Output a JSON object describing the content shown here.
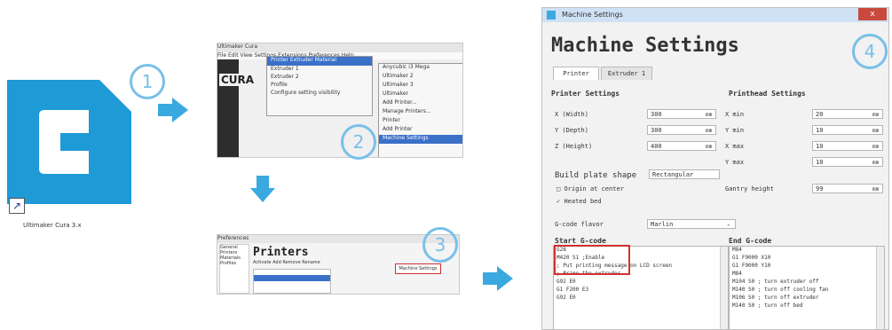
{
  "steps": [
    "1",
    "2",
    "3",
    "4"
  ],
  "colors": {
    "cura_blue": "#1e9ad6",
    "arrow_blue": "#3aa9e0",
    "highlight_red": "#d03030",
    "selection_blue": "#3a70c8"
  },
  "icon_caption": "Ultimaker Cura 3.x",
  "panel2": {
    "title": "Ultimaker Cura",
    "menu": "File  Edit  View  Settings  Extensions  Preferences  Help",
    "logo": "CURA",
    "dropdown_header": "Printer  Extruder  Material",
    "dropdown_items": [
      "Extruder 1",
      "Extruder 2",
      "Profile",
      "Configure setting visibility"
    ],
    "submenu_items": [
      "Anycubic i3 Mega",
      "Ultimaker 2",
      "Ultimaker 3",
      "Ultimaker",
      "Add Printer...",
      "Manage Printers...",
      "Printer",
      "Add Printer",
      "Machine Settings"
    ]
  },
  "panel3": {
    "title": "Preferences",
    "sidebar": [
      "General",
      "Printers",
      "Materials",
      "Profiles"
    ],
    "heading": "Printers",
    "tabs": "Activate  Add  Remove  Rename",
    "button": "Machine Settings"
  },
  "panel4": {
    "window_title": "Machine Settings",
    "close": "x",
    "heading": "Machine Settings",
    "tabs": [
      "Printer",
      "Extruder 1"
    ],
    "printer_settings_title": "Printer Settings",
    "printhead_settings_title": "Printhead Settings",
    "printer_fields": [
      {
        "label": "X (Width)",
        "value": "300",
        "unit": "mm"
      },
      {
        "label": "Y (Depth)",
        "value": "300",
        "unit": "mm"
      },
      {
        "label": "Z (Height)",
        "value": "400",
        "unit": "mm"
      }
    ],
    "printhead_fields": [
      {
        "label": "X min",
        "value": "20",
        "unit": "mm"
      },
      {
        "label": "Y min",
        "value": "10",
        "unit": "mm"
      },
      {
        "label": "X max",
        "value": "10",
        "unit": "mm"
      },
      {
        "label": "Y max",
        "value": "10",
        "unit": "mm"
      }
    ],
    "build_plate_label": "Build plate shape",
    "build_plate_value": "Rectangular",
    "gantry_label": "Gantry height",
    "gantry_value": "99",
    "gantry_unit": "mm",
    "origin_label": "Origin at center",
    "heated_bed_label": "Heated bed",
    "gcode_flavor_label": "G-code flavor",
    "gcode_flavor_value": "Marlin",
    "start_gcode_title": "Start G-code",
    "end_gcode_title": "End G-code",
    "start_gcode": [
      "G28",
      "M420 S1 ;Enable",
      "; Put printing message on LCD screen",
      "; Prime the extruder",
      "G92 E0",
      "G1 F200 E3",
      "G92 E0"
    ],
    "end_gcode": [
      "M84",
      "G1 F9000 X10",
      "G1 F9000 Y10",
      "M84",
      "M104 S0 ; turn extruder off",
      "M140 S0 ; turn off cooling fan",
      "M106 S0 ; turn off extruder",
      "M140 S0 ; turn off bed"
    ]
  }
}
